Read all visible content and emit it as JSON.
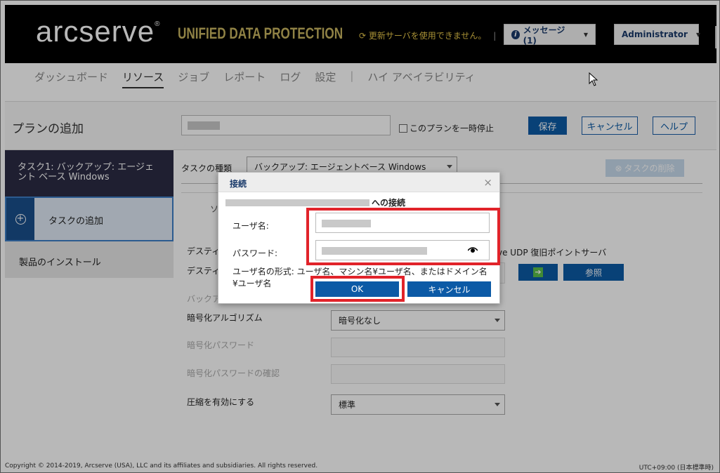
{
  "header": {
    "logo": "arcserve",
    "logo_mark": "®",
    "product": "UNIFIED DATA PROTECTION",
    "update_message": "更新サーバを使用できません。",
    "update_separator": "|",
    "messages_button": "メッセージ (1)",
    "user_button": "Administrator"
  },
  "nav": {
    "items": [
      "ダッシュボード",
      "リソース",
      "ジョブ",
      "レポート",
      "ログ",
      "設定"
    ],
    "separator": "|",
    "ha": "ハイ アベイラビリティ"
  },
  "plan": {
    "title": "プランの追加",
    "pause_label": "このプランを一時停止",
    "save": "保存",
    "cancel": "キャンセル",
    "help": "ヘルプ"
  },
  "sidebar": {
    "task1": "タスク1: バックアップ: エージェント ベース Windows",
    "add_task": "タスクの追加",
    "install": "製品のインストール"
  },
  "form": {
    "task_type_label": "タスクの種類",
    "task_type_value": "バックアップ: エージェントベース Windows",
    "delete_task": "タスクの削除",
    "tab_partial": "ソ",
    "dest_label1": "デスティネ",
    "dest_label2": "デスティネ",
    "dest_right": "ve UDP 復旧ポイントサーバ",
    "backup_partial": "バックア",
    "browse": "参照",
    "encryption_label": "暗号化アルゴリズム",
    "encryption_value": "暗号化なし",
    "enc_password": "暗号化パスワード",
    "enc_password_confirm": "暗号化パスワードの確認",
    "compression_label": "圧縮を有効にする",
    "compression_value": "標準"
  },
  "dialog": {
    "title": "接続",
    "close": "×",
    "connect_suffix": "への接続",
    "username_label": "ユーザ名:",
    "password_label": "パスワード:",
    "format_hint": "ユーザ名の形式: ユーザ名、マシン名¥ユーザ名、またはドメイン名¥ユーザ名",
    "ok": "OK",
    "cancel": "キャンセル"
  },
  "footer": {
    "copyright": "Copyright © 2014-2019, Arcserve (USA), LLC and its affiliates and subsidiaries. All rights reserved.",
    "timezone": "UTC+09:00 (日本標準時)"
  },
  "colors": {
    "primary_blue": "#0c5aa6",
    "highlight_red": "#e1232a",
    "header_gold": "#c8b560"
  }
}
